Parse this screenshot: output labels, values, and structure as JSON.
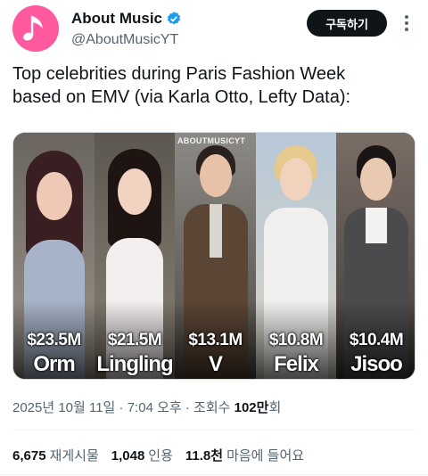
{
  "account": {
    "display_name": "About Music",
    "handle": "@AboutMusicYT",
    "subscribe_label": "구독하기",
    "avatar_icon": "music-note-icon",
    "verified_icon": "verified-badge-icon",
    "brand_color": "#ff5aa0",
    "verified_color": "#1d9bf0"
  },
  "tweet": {
    "text": "Top celebrities during Paris Fashion Week\nbased on EMV (via Karla Otto, Lefty Data):"
  },
  "media": {
    "watermark": "ABOUTMUSICYT",
    "celebrities": [
      {
        "value": "$23.5M",
        "name": "Orm"
      },
      {
        "value": "$21.5M",
        "name": "Lingling"
      },
      {
        "value": "$13.1M",
        "name": "V"
      },
      {
        "value": "$10.8M",
        "name": "Felix"
      },
      {
        "value": "$10.4M",
        "name": "Jisoo"
      }
    ]
  },
  "meta": {
    "date": "2025년 10월 11일",
    "separator1": "·",
    "time": "7:04 오후",
    "separator2": "·",
    "views_label": "조회수",
    "views_value": "102만",
    "views_suffix": "회"
  },
  "stats": {
    "reposts_value": "6,675",
    "reposts_label": "재게시물",
    "quotes_value": "1,048",
    "quotes_label": "인용",
    "likes_value": "11.8천",
    "likes_label": "마음에 들어요"
  }
}
